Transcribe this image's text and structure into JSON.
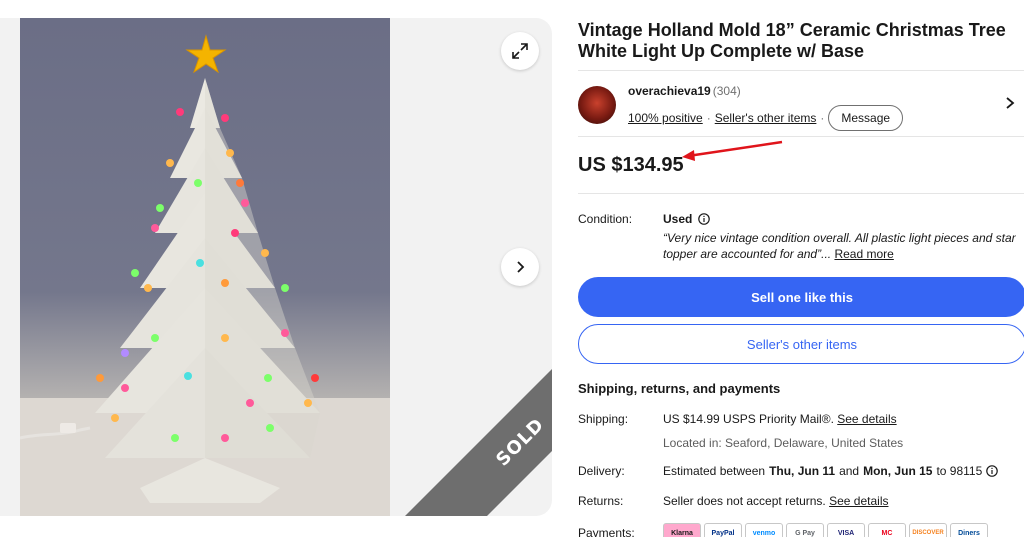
{
  "listing": {
    "title": "Vintage Holland Mold 18” Ceramic Christmas Tree White Light Up Complete w/ Base",
    "sold_ribbon": "SOLD"
  },
  "seller": {
    "name": "overachieva19",
    "feedback_count": "(304)",
    "positive": "100% positive",
    "other_items_link": "Seller's other items",
    "message_button": "Message"
  },
  "price": "US $134.95",
  "condition": {
    "label": "Condition:",
    "value": "Used",
    "quote": "“Very nice vintage condition overall. All plastic light pieces and star topper are accounted for and”...",
    "read_more": "Read more"
  },
  "actions": {
    "sell_one": "Sell one like this",
    "sellers_other_items": "Seller's other items"
  },
  "shipping_section": {
    "title": "Shipping, returns, and payments",
    "shipping_label": "Shipping:",
    "shipping_value": "US $14.99 USPS Priority Mail®.",
    "see_details": "See details",
    "located": "Located in: Seaford, Delaware, United States",
    "delivery_label": "Delivery:",
    "delivery_prefix": "Estimated between",
    "delivery_start": "Thu, Jun 11",
    "delivery_and": "and",
    "delivery_end": "Mon, Jun 15",
    "delivery_suffix": "to 98115",
    "returns_label": "Returns:",
    "returns_value": "Seller does not accept returns.",
    "returns_details": "See details",
    "payments_label": "Payments:",
    "payment_methods": [
      "Klarna",
      "PayPal",
      "venmo",
      "G Pay",
      "VISA",
      "MC",
      "DISCOVER",
      "Diners"
    ]
  },
  "colors": {
    "primary": "#3665f3",
    "annotation_arrow": "#e0141b",
    "sold_ribbon": "#6e6e6e"
  }
}
